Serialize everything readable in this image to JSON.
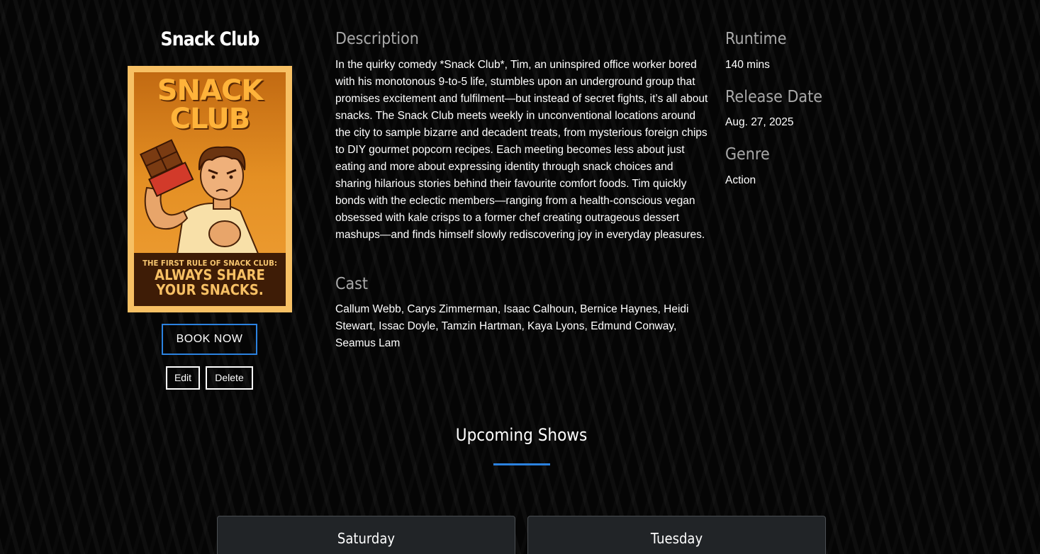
{
  "movie": {
    "title": "Snack Club",
    "poster": {
      "headline_line1": "SNACK",
      "headline_line2": "CLUB",
      "tagline_line1": "THE FIRST RULE OF SNACK CLUB:",
      "tagline_line2": "ALWAYS SHARE",
      "tagline_line3": "YOUR SNACKS."
    },
    "book_label": "BOOK NOW",
    "edit_label": "Edit",
    "delete_label": "Delete"
  },
  "details": {
    "description_heading": "Description",
    "description": "In the quirky comedy *Snack Club*, Tim, an uninspired office worker bored with his monotonous 9-to-5 life, stumbles upon an underground group that promises excitement and fulfilment—but instead of secret fights, it’s all about snacks. The Snack Club meets weekly in unconventional locations around the city to sample bizarre and decadent treats, from mysterious foreign chips to DIY gourmet popcorn recipes. Each meeting becomes less about just eating and more about expressing identity through snack choices and sharing hilarious stories behind their favourite comfort foods. Tim quickly bonds with the eclectic members—ranging from a health-conscious vegan obsessed with kale crisps to a former chef creating outrageous dessert mashups—and finds himself slowly rediscovering joy in everyday pleasures.",
    "cast_heading": "Cast",
    "cast": "Callum Webb, Carys Zimmerman, Isaac Calhoun, Bernice Haynes, Heidi Stewart, Issac Doyle, Tamzin Hartman, Kaya Lyons, Edmund Conway, Seamus Lam",
    "runtime_heading": "Runtime",
    "runtime": "140 mins",
    "release_heading": "Release Date",
    "release": "Aug. 27, 2025",
    "genre_heading": "Genre",
    "genre": "Action"
  },
  "upcoming": {
    "heading": "Upcoming Shows",
    "shows": [
      {
        "day": "Saturday"
      },
      {
        "day": "Tuesday"
      }
    ]
  },
  "colors": {
    "accent": "#2b82e0",
    "background": "#050505",
    "card": "#212427",
    "heading_gray": "#a9a9a9"
  }
}
